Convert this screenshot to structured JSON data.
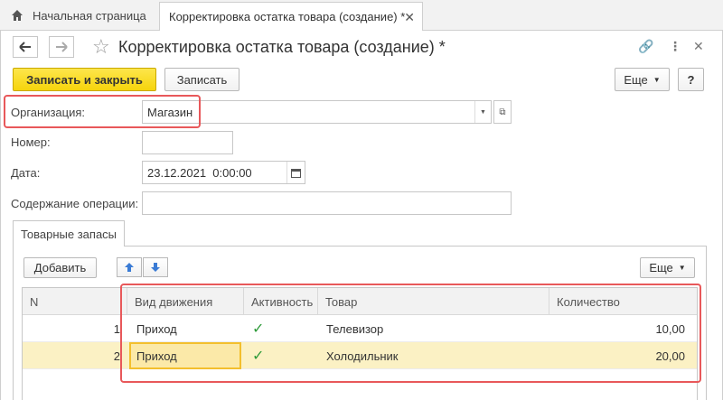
{
  "tabs": {
    "home_label": "Начальная страница",
    "doc_label": "Корректировка остатка товара (создание) *"
  },
  "window": {
    "title": "Корректировка остатка товара (создание) *",
    "back_icon": "arrow-left-icon",
    "forward_icon": "arrow-right-icon",
    "star_icon": "star-icon"
  },
  "toolbar": {
    "save_close_label": "Записать и закрыть",
    "save_label": "Записать",
    "more_label": "Еще",
    "help_label": "?"
  },
  "form": {
    "org_label": "Организация:",
    "org_value": "Магазин",
    "number_label": "Номер:",
    "number_value": "",
    "date_label": "Дата:",
    "date_value": "23.12.2021  0:00:00",
    "content_label": "Содержание операции:",
    "content_value": ""
  },
  "inner_tab": {
    "label": "Товарные запасы",
    "add_label": "Добавить",
    "more_label": "Еще"
  },
  "table": {
    "headers": [
      "N",
      "Вид движения",
      "Активность",
      "Товар",
      "Количество"
    ],
    "rows": [
      {
        "n": "1",
        "movement": "Приход",
        "active": true,
        "product": "Телевизор",
        "qty": "10,00"
      },
      {
        "n": "2",
        "movement": "Приход",
        "active": true,
        "product": "Холодильник",
        "qty": "20,00"
      }
    ]
  },
  "colors": {
    "primary_button": "#f6d40c",
    "highlight": "#e8585a",
    "selected_row": "#fbf1c4",
    "check": "#2e9b3a"
  }
}
